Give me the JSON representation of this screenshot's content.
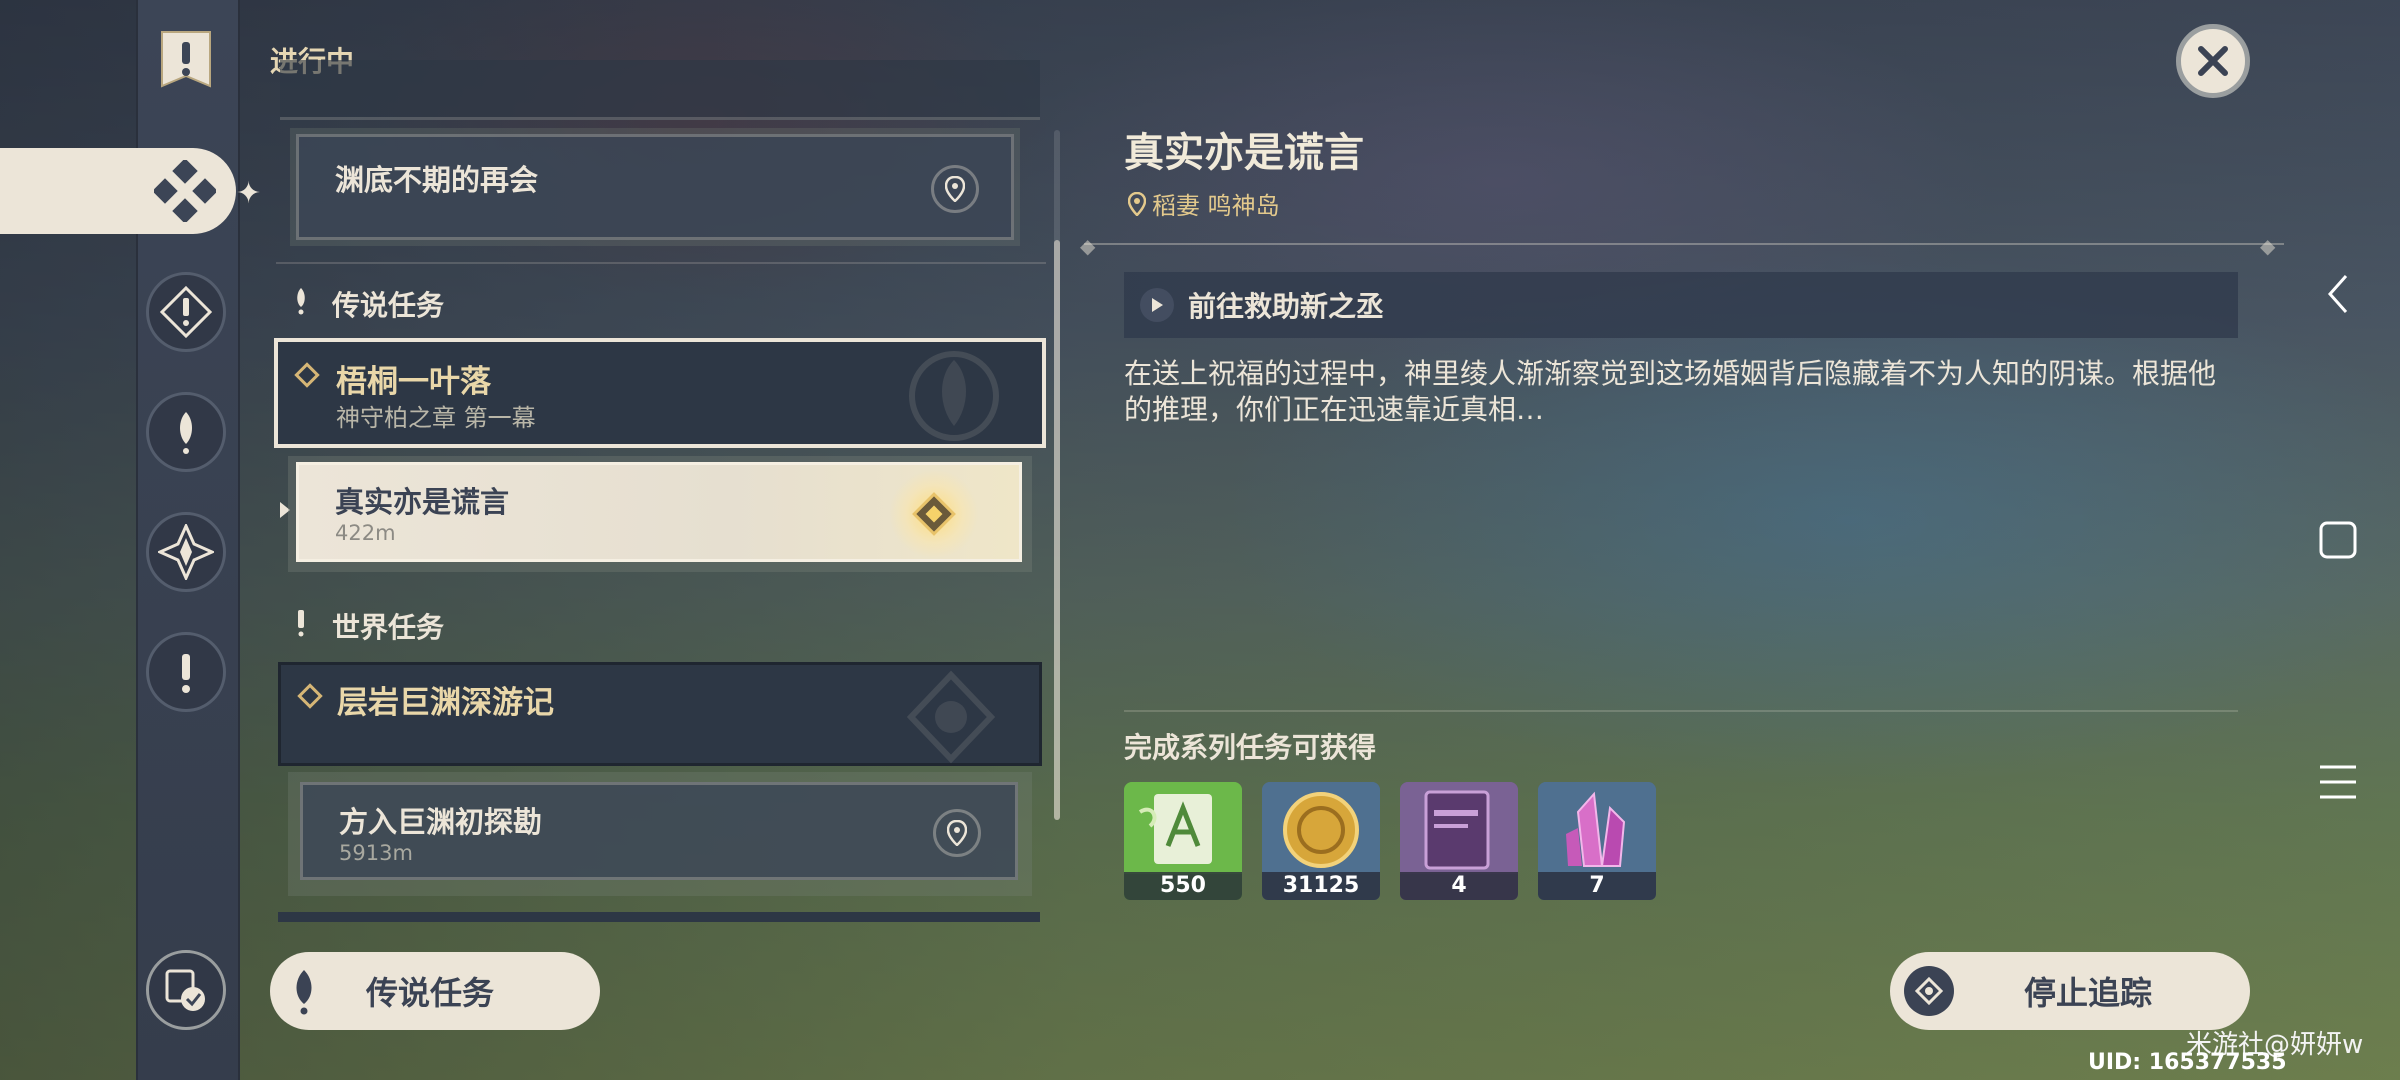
{
  "header": {
    "in_progress_label": "进行中"
  },
  "quest_list": {
    "top_quest": {
      "title": "渊底不期的再会"
    },
    "legend_section": {
      "label": "传说任务"
    },
    "legend_quest": {
      "title": "梧桐一叶落",
      "subtitle": "神守柏之章 第一幕",
      "subquest": {
        "title": "真实亦是谎言",
        "distance": "422m"
      }
    },
    "world_section": {
      "label": "世界任务"
    },
    "world_quest": {
      "title": "层岩巨渊深游记",
      "subquest": {
        "title": "方入巨渊初探勘",
        "distance": "5913m"
      }
    }
  },
  "detail": {
    "title": "真实亦是谎言",
    "location": "稻妻 鸣神岛",
    "step": "前往救助新之丞",
    "description": "在送上祝福的过程中，神里绫人渐渐察觉到这场婚姻背后隐藏着不为人知的阴谋。根据他的推理，你们正在迅速靠近真相…",
    "rewards_label": "完成系列任务可获得",
    "rewards": [
      {
        "icon": "adventure-exp-icon",
        "count": "550"
      },
      {
        "icon": "mora-icon",
        "count": "31125"
      },
      {
        "icon": "heros-wit-book-icon",
        "count": "4"
      },
      {
        "icon": "mystic-ore-crystal-icon",
        "count": "7"
      }
    ]
  },
  "buttons": {
    "legend_quests": "传说任务",
    "stop_tracking": "停止追踪"
  },
  "overlay": {
    "watermark": "米游社@妍妍w",
    "uid": "UID: 165377535"
  },
  "colors": {
    "accent_cream": "#ece5d8",
    "gold": "#e3c98c",
    "panel_dark": "#2d3745"
  }
}
